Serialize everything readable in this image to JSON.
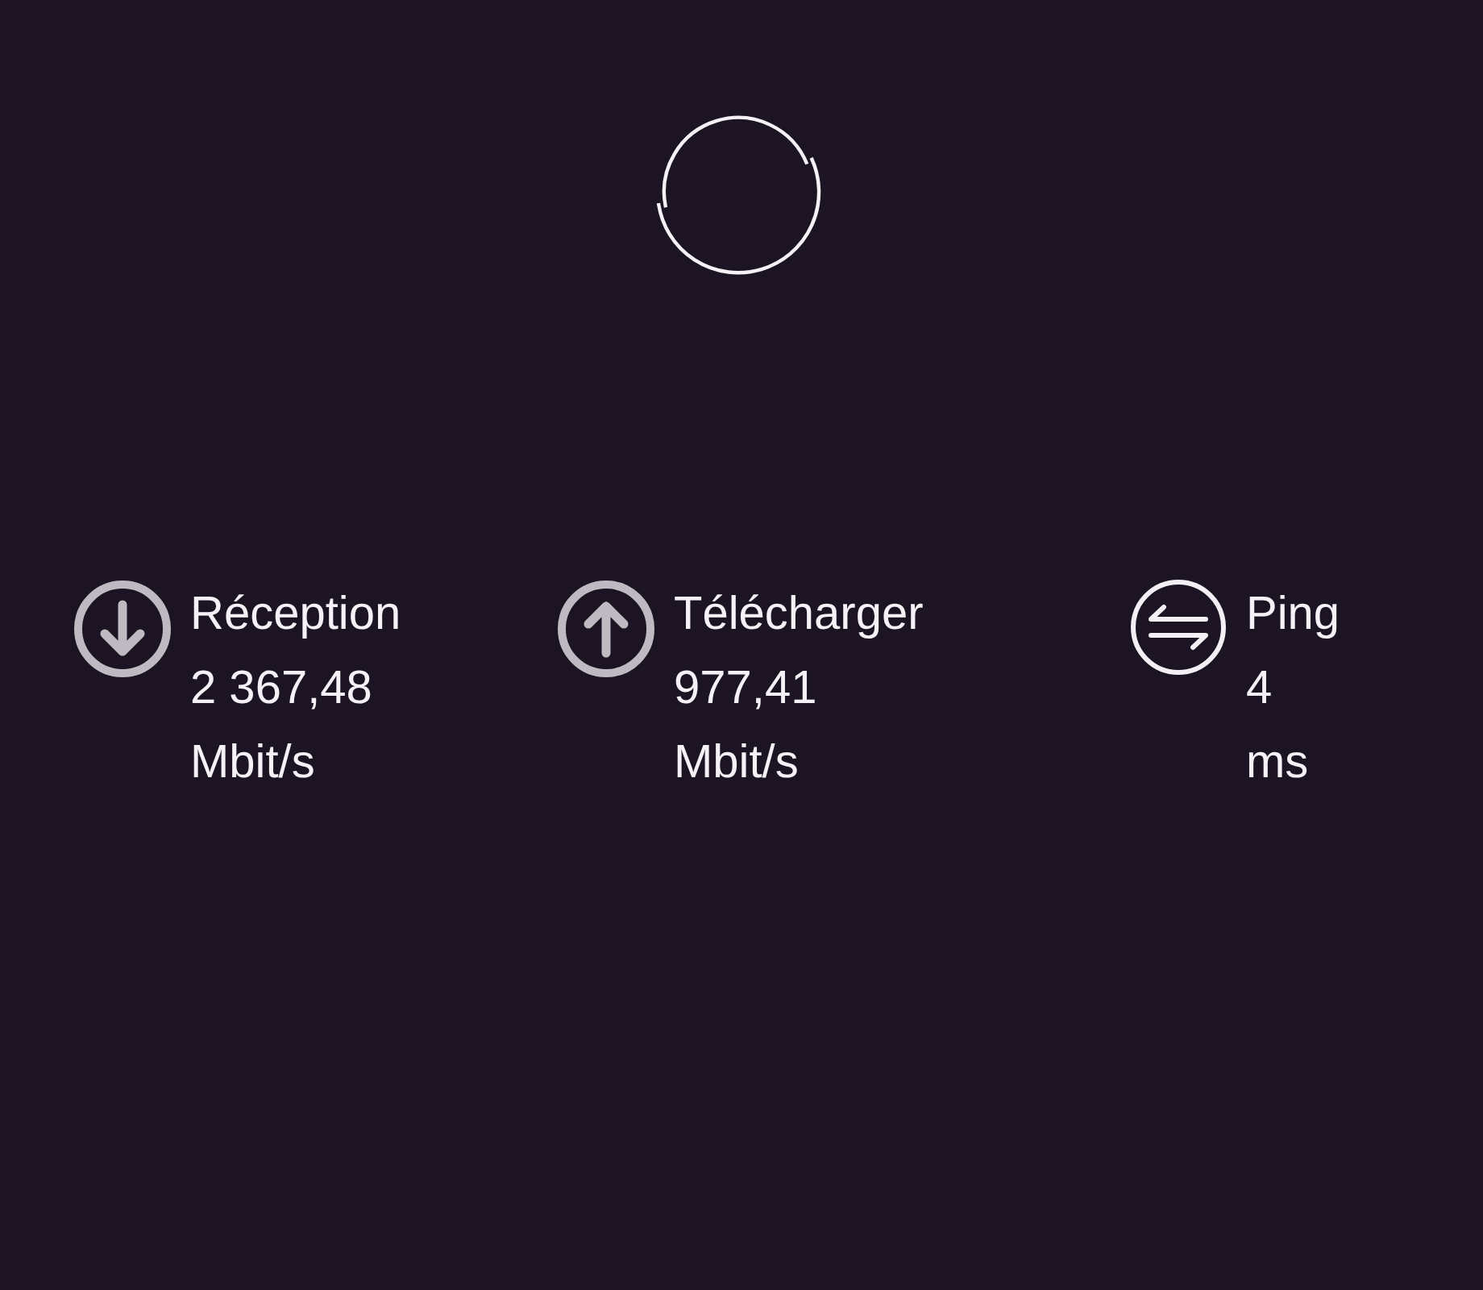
{
  "metrics": [
    {
      "kind": "download",
      "label": "Réception",
      "value": "2 367,48",
      "unit": "Mbit/s"
    },
    {
      "kind": "upload",
      "label": "Télécharger",
      "value": "977,41",
      "unit": "Mbit/s"
    },
    {
      "kind": "ping",
      "label": "Ping",
      "value": "4",
      "unit": "ms"
    }
  ]
}
